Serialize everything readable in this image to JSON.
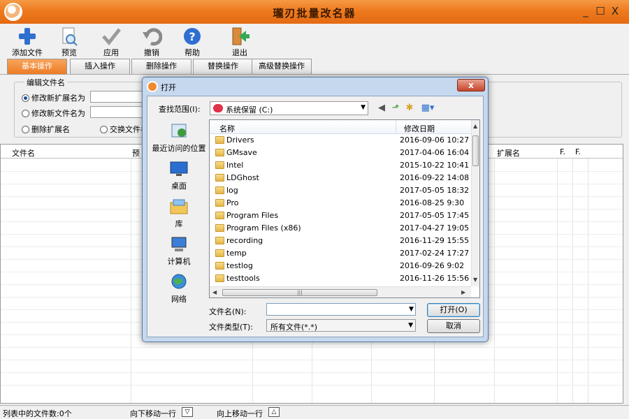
{
  "app": {
    "title": "瓏刃批量改名器",
    "window_controls": {
      "minimize": "_",
      "maximize": "☐",
      "close": "X"
    }
  },
  "toolbar": [
    {
      "label": "添加文件",
      "icon": "add-file-icon"
    },
    {
      "label": "预览",
      "icon": "preview-icon"
    },
    {
      "label": "应用",
      "icon": "apply-check-icon"
    },
    {
      "label": "撤销",
      "icon": "undo-icon"
    },
    {
      "label": "帮助",
      "icon": "help-icon"
    },
    {
      "label": "退出",
      "icon": "exit-icon"
    }
  ],
  "tabs": [
    "基本操作",
    "插入操作",
    "删除操作",
    "替换操作",
    "高级替换操作"
  ],
  "active_tab": 0,
  "edit": {
    "group_title": "编辑文件名",
    "opt_ext": "修改新扩展名为",
    "opt_name": "修改新文件名为",
    "opt_del_ext": "删除扩展名",
    "opt_swap": "交换文件名"
  },
  "table": {
    "columns": [
      "文件名",
      "预",
      "扩展名",
      "F.",
      "F."
    ]
  },
  "status": {
    "count": "列表中的文件数:0个",
    "move_down": "向下移动一行",
    "move_down_btn": "▽",
    "move_up": "向上移动一行",
    "move_up_btn": "△"
  },
  "dialog": {
    "title": "打开",
    "close": "x",
    "lookin_label": "查找范围(I):",
    "lookin_value": "系统保留 (C:)",
    "places": [
      {
        "label": "最近访问的位置",
        "icon": "recent-places-icon"
      },
      {
        "label": "桌面",
        "icon": "desktop-icon"
      },
      {
        "label": "库",
        "icon": "libraries-icon"
      },
      {
        "label": "计算机",
        "icon": "computer-icon"
      },
      {
        "label": "网络",
        "icon": "network-icon"
      }
    ],
    "col_name": "名称",
    "col_date": "修改日期",
    "files": [
      {
        "name": "Drivers",
        "date": "2016-09-06 10:27"
      },
      {
        "name": "GMsave",
        "date": "2017-04-06 16:04"
      },
      {
        "name": "Intel",
        "date": "2015-10-22 10:41"
      },
      {
        "name": "LDGhost",
        "date": "2016-09-22 14:08"
      },
      {
        "name": "log",
        "date": "2017-05-05 18:32"
      },
      {
        "name": "Pro",
        "date": "2016-08-25 9:30"
      },
      {
        "name": "Program Files",
        "date": "2017-05-05 17:45"
      },
      {
        "name": "Program Files (x86)",
        "date": "2017-04-27 19:05"
      },
      {
        "name": "recording",
        "date": "2016-11-29 15:55"
      },
      {
        "name": "temp",
        "date": "2017-02-24 17:27"
      },
      {
        "name": "testlog",
        "date": "2016-09-26 9:02"
      },
      {
        "name": "testtools",
        "date": "2016-11-26 15:56"
      }
    ],
    "filename_label": "文件名(N):",
    "filename_value": "",
    "filetype_label": "文件类型(T):",
    "filetype_value": "所有文件(*.*)",
    "open_btn": "打开(O)",
    "cancel_btn": "取消"
  }
}
